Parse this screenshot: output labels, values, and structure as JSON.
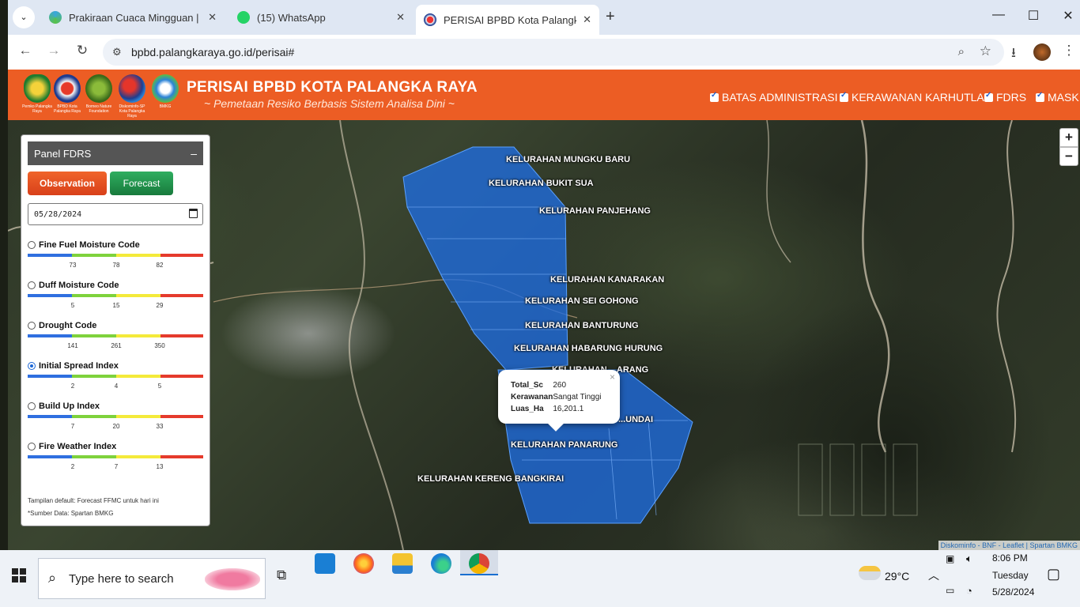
{
  "browser": {
    "tabs": [
      {
        "title": "Prakiraan Cuaca Mingguan | BMKG",
        "active": false
      },
      {
        "title": "(15) WhatsApp",
        "active": false
      },
      {
        "title": "PERISAI BPBD Kota Palangka Raya",
        "active": true
      }
    ],
    "url": "bpbd.palangkaraya.go.id/perisai#"
  },
  "header": {
    "title": "PERISAI BPBD KOTA PALANGKA RAYA",
    "subtitle": "~ Pemetaan Resiko Berbasis Sistem Analisa Dini ~",
    "logos": [
      {
        "caption": "Pemko Palangka Raya"
      },
      {
        "caption": "BPBD Kota Palangka Raya"
      },
      {
        "caption": "Borneo Nature Foundation"
      },
      {
        "caption": "Diskominfo-SP Kota Palangka Raya"
      },
      {
        "caption": "BMKG"
      }
    ],
    "layers": [
      {
        "label": "BATAS ADMINISTRASI",
        "checked": true
      },
      {
        "label": "KERAWANAN KARHUTLA",
        "checked": true
      },
      {
        "label": "FDRS",
        "checked": true
      },
      {
        "label": "MASK",
        "checked": true
      }
    ]
  },
  "panel": {
    "title": "Panel FDRS",
    "minimize": "–",
    "observation_label": "Observation",
    "forecast_label": "Forecast",
    "date_value": "05/28/2024",
    "indices": [
      {
        "label": "Fine Fuel Moisture Code",
        "ticks": [
          "73",
          "78",
          "82"
        ],
        "selected": false
      },
      {
        "label": "Duff Moisture Code",
        "ticks": [
          "5",
          "15",
          "29"
        ],
        "selected": false
      },
      {
        "label": "Drought Code",
        "ticks": [
          "141",
          "261",
          "350"
        ],
        "selected": false
      },
      {
        "label": "Initial Spread Index",
        "ticks": [
          "2",
          "4",
          "5"
        ],
        "selected": true
      },
      {
        "label": "Build Up Index",
        "ticks": [
          "7",
          "20",
          "33"
        ],
        "selected": false
      },
      {
        "label": "Fire Weather Index",
        "ticks": [
          "2",
          "7",
          "13"
        ],
        "selected": false
      }
    ],
    "colors": [
      "#2f6fe0",
      "#7ed23c",
      "#f4ea3a",
      "#e53a2c"
    ],
    "note_default": "Tampilan default: Forecast FFMC untuk hari ini",
    "note_source": "*Sumber Data: Spartan BMKG"
  },
  "map": {
    "kelurahan": [
      "KELURAHAN MUNGKU BARU",
      "KELURAHAN BUKIT SUA",
      "KELURAHAN PANJEHANG",
      "KELURAHAN KANARAKAN",
      "KELURAHAN SEI GOHONG",
      "KELURAHAN BANTURUNG",
      "KELURAHAN HABARUNG HURUNG",
      "KELURAHAN ...ARANG",
      "...UNDAI",
      "KELURAHAN PANARUNG",
      "KELURAHAN KERENG BANGKIRAI"
    ],
    "popup": {
      "rows": [
        {
          "key": "Total_Sc",
          "value": "260"
        },
        {
          "key": "Kerawanan",
          "value": "Sangat Tinggi"
        },
        {
          "key": "Luas_Ha",
          "value": "16,201.1"
        }
      ],
      "close": "×"
    },
    "zoom_in": "+",
    "zoom_out": "−",
    "attribution": "Diskominfo - BNF - Leaflet | Spartan BMKG"
  },
  "taskbar": {
    "search_placeholder": "Type here to search",
    "weather": "29°C",
    "time": "8:06 PM",
    "day": "Tuesday",
    "date": "5/28/2024"
  }
}
